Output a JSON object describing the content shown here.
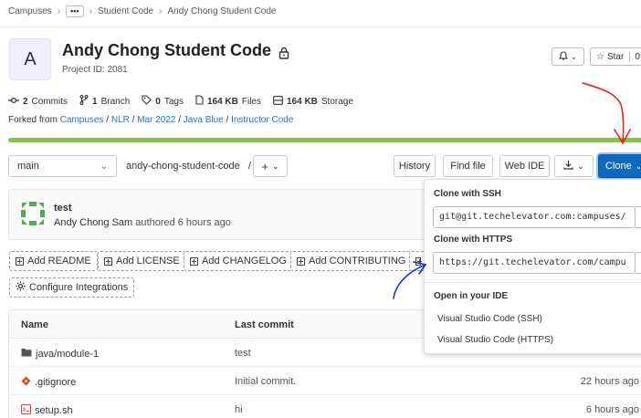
{
  "breadcrumb": {
    "root": "Campuses",
    "more": "•••",
    "group": "Student Code",
    "current": "Andy Chong Student Code"
  },
  "project": {
    "avatar_letter": "A",
    "title": "Andy Chong Student Code",
    "id_text": "Project ID: 2081"
  },
  "header_actions": {
    "star_label": "Star",
    "star_count": "0"
  },
  "stats": {
    "commits_count": "2",
    "commits_label": "Commits",
    "branches_count": "1",
    "branches_label": "Branch",
    "tags_count": "0",
    "tags_label": "Tags",
    "files_size": "164 KB",
    "files_label": "Files",
    "storage_size": "164 KB",
    "storage_label": "Storage"
  },
  "forked": {
    "prefix": "Forked from ",
    "path": [
      "Campuses",
      "NLR",
      "Mar 2022",
      "Java Blue",
      "Instructor Code"
    ],
    "sep": " / "
  },
  "progress": {
    "fill_percent": 100,
    "color": "#81c842"
  },
  "toolbar": {
    "branch": "main",
    "path": "andy-chong-student-code",
    "path_sep": "/",
    "history": "History",
    "find_file": "Find file",
    "web_ide": "Web IDE",
    "clone": "Clone"
  },
  "commit": {
    "title": "test",
    "author": "Andy Chong Sam",
    "authored": "authored 6 hours ago"
  },
  "shortcuts": {
    "add_readme": "Add README",
    "add_license": "Add LICENSE",
    "add_changelog": "Add CHANGELOG",
    "add_contributing": "Add CONTRIBUTING",
    "configure": "Configure Integrations"
  },
  "file_table": {
    "col_name": "Name",
    "col_commit": "Last commit",
    "rows": [
      {
        "name": "java/module-1",
        "commit": "test",
        "time": ""
      },
      {
        "name": ".gitignore",
        "commit": "Initial commit.",
        "time": "22 hours ago"
      },
      {
        "name": "setup.sh",
        "commit": "hi",
        "time": "6 hours ago"
      }
    ]
  },
  "clone_dropdown": {
    "ssh_label": "Clone with SSH",
    "ssh_url": "git@git.techelevator.com:campuses/",
    "https_label": "Clone with HTTPS",
    "https_url": "https://git.techelevator.com/campu",
    "ide_label": "Open in your IDE",
    "vscode_ssh": "Visual Studio Code (SSH)",
    "vscode_https": "Visual Studio Code (HTTPS)"
  },
  "colors": {
    "link": "#1f75cb",
    "primary": "#1068bf",
    "annotation_red": "#e8241c",
    "annotation_blue": "#1833d6"
  }
}
